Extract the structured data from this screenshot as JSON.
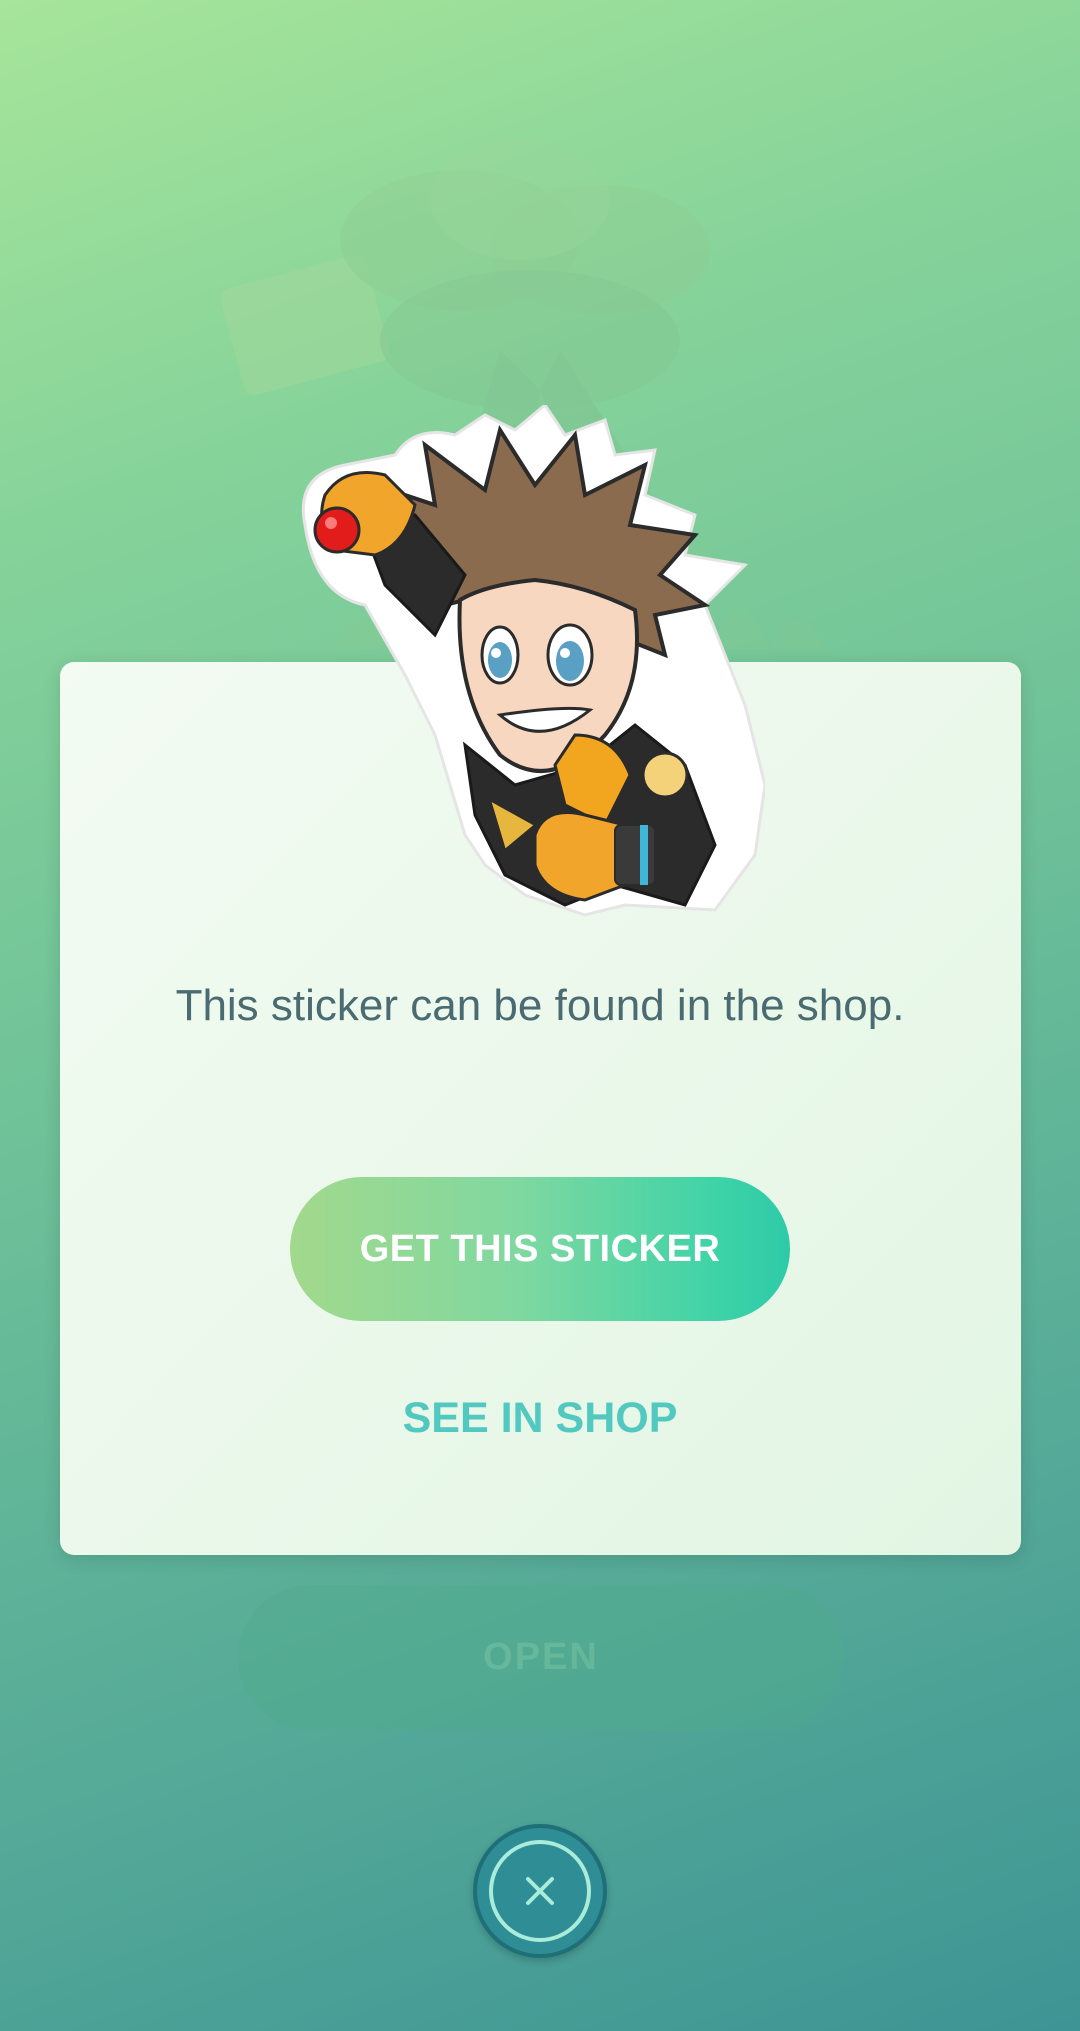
{
  "background": {
    "open_button_label": "OPEN"
  },
  "dialog": {
    "message": "This sticker can be found in the shop.",
    "primary_button_label": "GET THIS STICKER",
    "secondary_button_label": "SEE IN SHOP",
    "sticker_name": "team-instinct-leader-sticker-icon"
  },
  "colors": {
    "card_background": "#eaf8ea",
    "primary_gradient_start": "#a2d98c",
    "primary_gradient_end": "#2ecaa8",
    "link_text": "#52c9c0",
    "close_button": "#2f8d96"
  },
  "close_icon": "close-icon"
}
